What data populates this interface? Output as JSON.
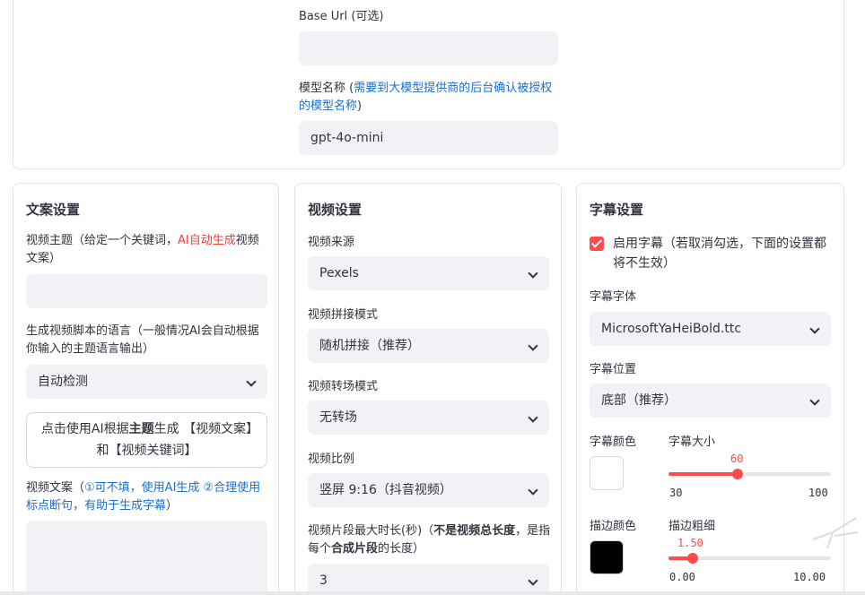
{
  "llm": {
    "base_url_label": "Base Url (可选)",
    "base_url_value": "",
    "model_label_prefix": "模型名称 (",
    "model_label_link": "需要到大模型提供商的后台确认被授权的模型名称",
    "model_label_suffix": ")",
    "model_value": "gpt-4o-mini"
  },
  "copy_settings": {
    "title": "文案设置",
    "topic_label_a": "视频主题（给定一个关键词，",
    "topic_label_red": "AI自动生成",
    "topic_label_b": "视频文案）",
    "topic_value": "",
    "language_label": "生成视频脚本的语言（一般情况AI会自动根据你输入的主题语言输出）",
    "language_value": "自动检测",
    "generate_button_a": "点击使用AI根据",
    "generate_button_bold": "主题",
    "generate_button_b": "生成 【视频文案】和【视频关键词】",
    "script_label_a": "视频文案（",
    "script_label_blue": "①可不填，使用AI生成 ②合理使用标点断句，有助于生成字幕",
    "script_label_b": "）",
    "script_value": ""
  },
  "video_settings": {
    "title": "视频设置",
    "source_label": "视频来源",
    "source_value": "Pexels",
    "concat_label": "视频拼接模式",
    "concat_value": "随机拼接（推荐）",
    "transition_label": "视频转场模式",
    "transition_value": "无转场",
    "ratio_label": "视频比例",
    "ratio_value": "竖屏 9:16（抖音视频）",
    "clip_label_a": "视频片段最大时长(秒)（",
    "clip_label_bold1": "不是视频总长度",
    "clip_label_b": "，是指每个",
    "clip_label_bold2": "合成片段",
    "clip_label_c": "的长度）",
    "clip_value": "3"
  },
  "subtitle_settings": {
    "title": "字幕设置",
    "enable_label": "启用字幕（若取消勾选，下面的设置都将不生效）",
    "enable_checked": true,
    "font_label": "字幕字体",
    "font_value": "MicrosoftYaHeiBold.ttc",
    "position_label": "字幕位置",
    "position_value": "底部（推荐）",
    "color_label": "字幕颜色",
    "color_value": "#ffffff",
    "size_label": "字幕大小",
    "size_value": "60",
    "size_min": "30",
    "size_max": "100",
    "stroke_color_label": "描边颜色",
    "stroke_color_value": "#000000",
    "stroke_width_label": "描边粗细",
    "stroke_width_value": "1.50",
    "stroke_width_min": "0.00",
    "stroke_width_max": "10.00"
  },
  "colors": {
    "accent": "#ff4b4b",
    "link": "#1a6fd1",
    "input_bg": "#f0f2f6"
  }
}
